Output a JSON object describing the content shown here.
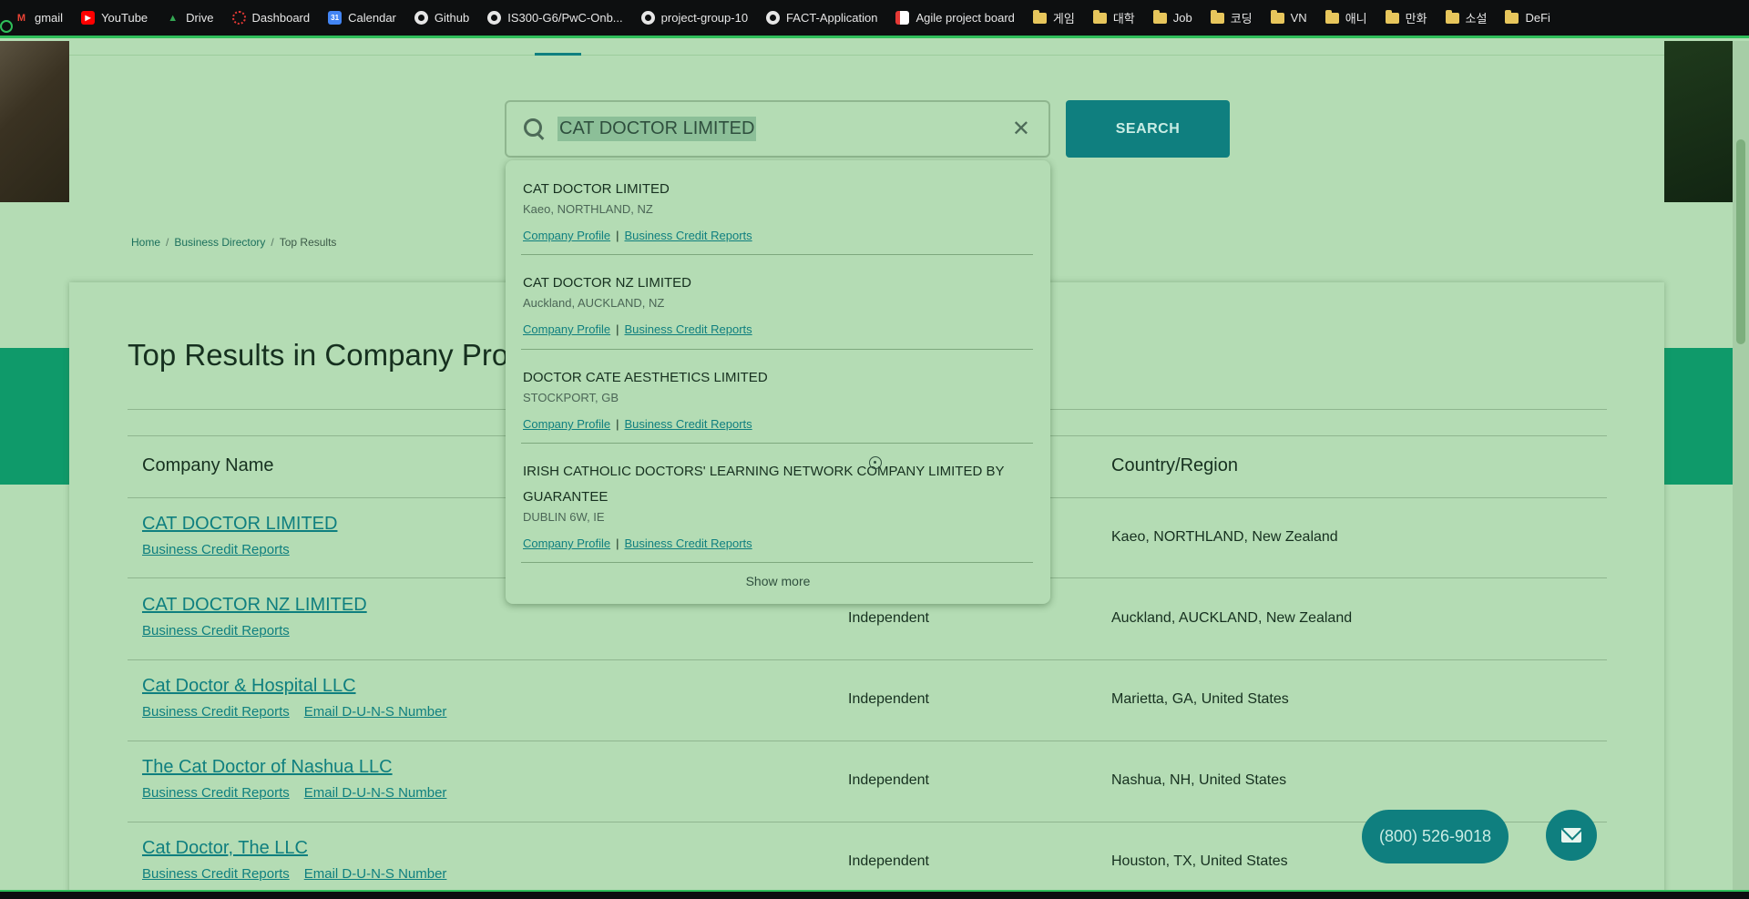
{
  "bookmarks": [
    {
      "label": "gmail",
      "icon": "gmail-icon",
      "color": "#ea4335"
    },
    {
      "label": "YouTube",
      "icon": "youtube-icon",
      "color": "#ff0000"
    },
    {
      "label": "Drive",
      "icon": "drive-icon",
      "color": "#34a853"
    },
    {
      "label": "Dashboard",
      "icon": "dashboard-icon",
      "color": "#e53935"
    },
    {
      "label": "Calendar",
      "icon": "calendar-icon",
      "color": "#4285f4"
    },
    {
      "label": "Github",
      "icon": "github-icon",
      "color": "#e6e6e6"
    },
    {
      "label": "IS300-G6/PwC-Onb...",
      "icon": "github-icon",
      "color": "#e6e6e6"
    },
    {
      "label": "project-group-10",
      "icon": "github-icon",
      "color": "#e6e6e6"
    },
    {
      "label": "FACT-Application",
      "icon": "github-icon",
      "color": "#e6e6e6"
    },
    {
      "label": "Agile project board",
      "icon": "board-icon",
      "color": "#e53935"
    },
    {
      "label": "게임",
      "icon": "folder-icon",
      "color": "#e7c65c"
    },
    {
      "label": "대학",
      "icon": "folder-icon",
      "color": "#e7c65c"
    },
    {
      "label": "Job",
      "icon": "folder-icon",
      "color": "#e7c65c"
    },
    {
      "label": "코딩",
      "icon": "folder-icon",
      "color": "#e7c65c"
    },
    {
      "label": "VN",
      "icon": "folder-icon",
      "color": "#e7c65c"
    },
    {
      "label": "애니",
      "icon": "folder-icon",
      "color": "#e7c65c"
    },
    {
      "label": "만화",
      "icon": "folder-icon",
      "color": "#e7c65c"
    },
    {
      "label": "소설",
      "icon": "folder-icon",
      "color": "#e7c65c"
    },
    {
      "label": "DeFi",
      "icon": "folder-icon",
      "color": "#e7c65c"
    }
  ],
  "search": {
    "value": "CAT DOCTOR LIMITED",
    "button_label": "SEARCH"
  },
  "breadcrumb": [
    "Home",
    "Business Directory",
    "Top Results"
  ],
  "results": {
    "title": "Top Results in Company Prof",
    "headers": {
      "name": "Company Name",
      "country": "Country/Region"
    },
    "rows": [
      {
        "name": "CAT DOCTOR LIMITED",
        "links": [
          "Business Credit Reports"
        ],
        "type": "",
        "location": "Kaeo, NORTHLAND, New Zealand"
      },
      {
        "name": "CAT DOCTOR NZ LIMITED",
        "links": [
          "Business Credit Reports"
        ],
        "type": "Independent",
        "location": "Auckland, AUCKLAND, New Zealand"
      },
      {
        "name": "Cat Doctor & Hospital LLC",
        "links": [
          "Business Credit Reports",
          "Email D-U-N-S Number"
        ],
        "type": "Independent",
        "location": "Marietta, GA, United States"
      },
      {
        "name": "The Cat Doctor of Nashua LLC",
        "links": [
          "Business Credit Reports",
          "Email D-U-N-S Number"
        ],
        "type": "Independent",
        "location": "Nashua, NH, United States"
      },
      {
        "name": "Cat Doctor, The LLC",
        "links": [
          "Business Credit Reports",
          "Email D-U-N-S Number"
        ],
        "type": "Independent",
        "location": "Houston, TX, United States"
      }
    ]
  },
  "dropdown": {
    "items": [
      {
        "name": "CAT DOCTOR LIMITED",
        "location": "Kaeo, NORTHLAND, NZ"
      },
      {
        "name": "CAT DOCTOR NZ LIMITED",
        "location": "Auckland, AUCKLAND, NZ"
      },
      {
        "name": "DOCTOR CATE AESTHETICS LIMITED",
        "location": "STOCKPORT, GB"
      },
      {
        "name": "IRISH CATHOLIC DOCTORS' LEARNING NETWORK COMPANY LIMITED BY GUARANTEE",
        "location": "DUBLIN 6W, IE"
      }
    ],
    "link_profile": "Company Profile",
    "link_separator": "|",
    "link_credit": "Business Credit Reports",
    "show_more": "Show more"
  },
  "contact": {
    "phone": "(800) 526-9018"
  },
  "colors": {
    "accent": "#0f7f7f",
    "background": "#b4dcb4",
    "brand_green": "#0f9a6a"
  }
}
